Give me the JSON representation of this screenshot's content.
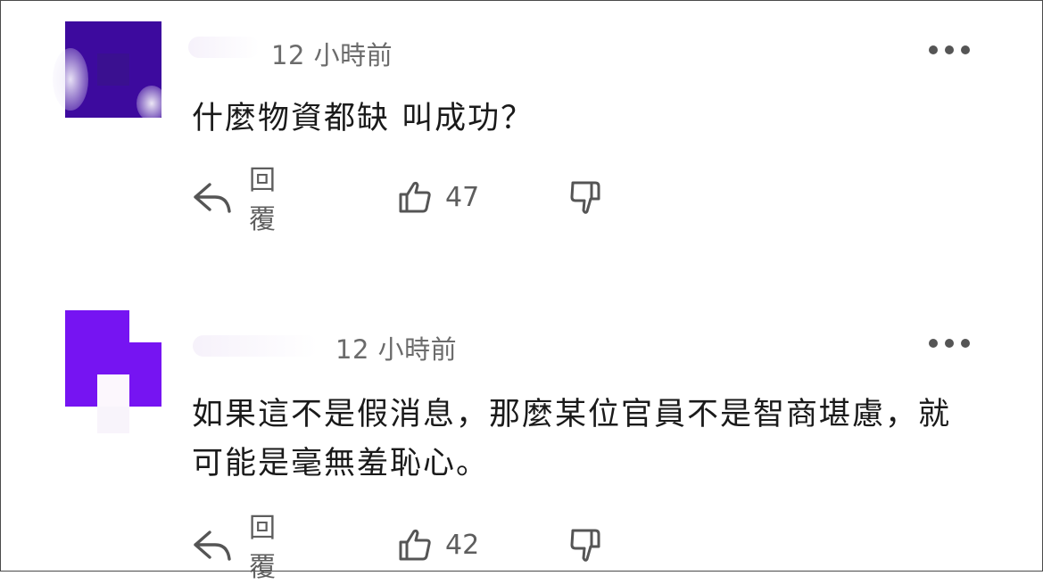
{
  "comments": [
    {
      "timestamp": "12 小時前",
      "text": "什麼物資都缺 叫成功？",
      "reply_label": "回覆",
      "likes": "47",
      "avatar_color": "#3d0a9e"
    },
    {
      "timestamp": "12 小時前",
      "text": "如果這不是假消息，那麼某位官員不是智商堪慮，就可能是毫無羞恥心。",
      "reply_label": "回覆",
      "likes": "42",
      "avatar_color": "#7614f2"
    }
  ],
  "icons": {
    "more": "more-horizontal-icon",
    "reply": "reply-arrow-icon",
    "like": "thumbs-up-icon",
    "dislike": "thumbs-down-icon"
  },
  "colors": {
    "text": "#1a1a1a",
    "muted": "#6b6b6b",
    "icon": "#555555"
  }
}
